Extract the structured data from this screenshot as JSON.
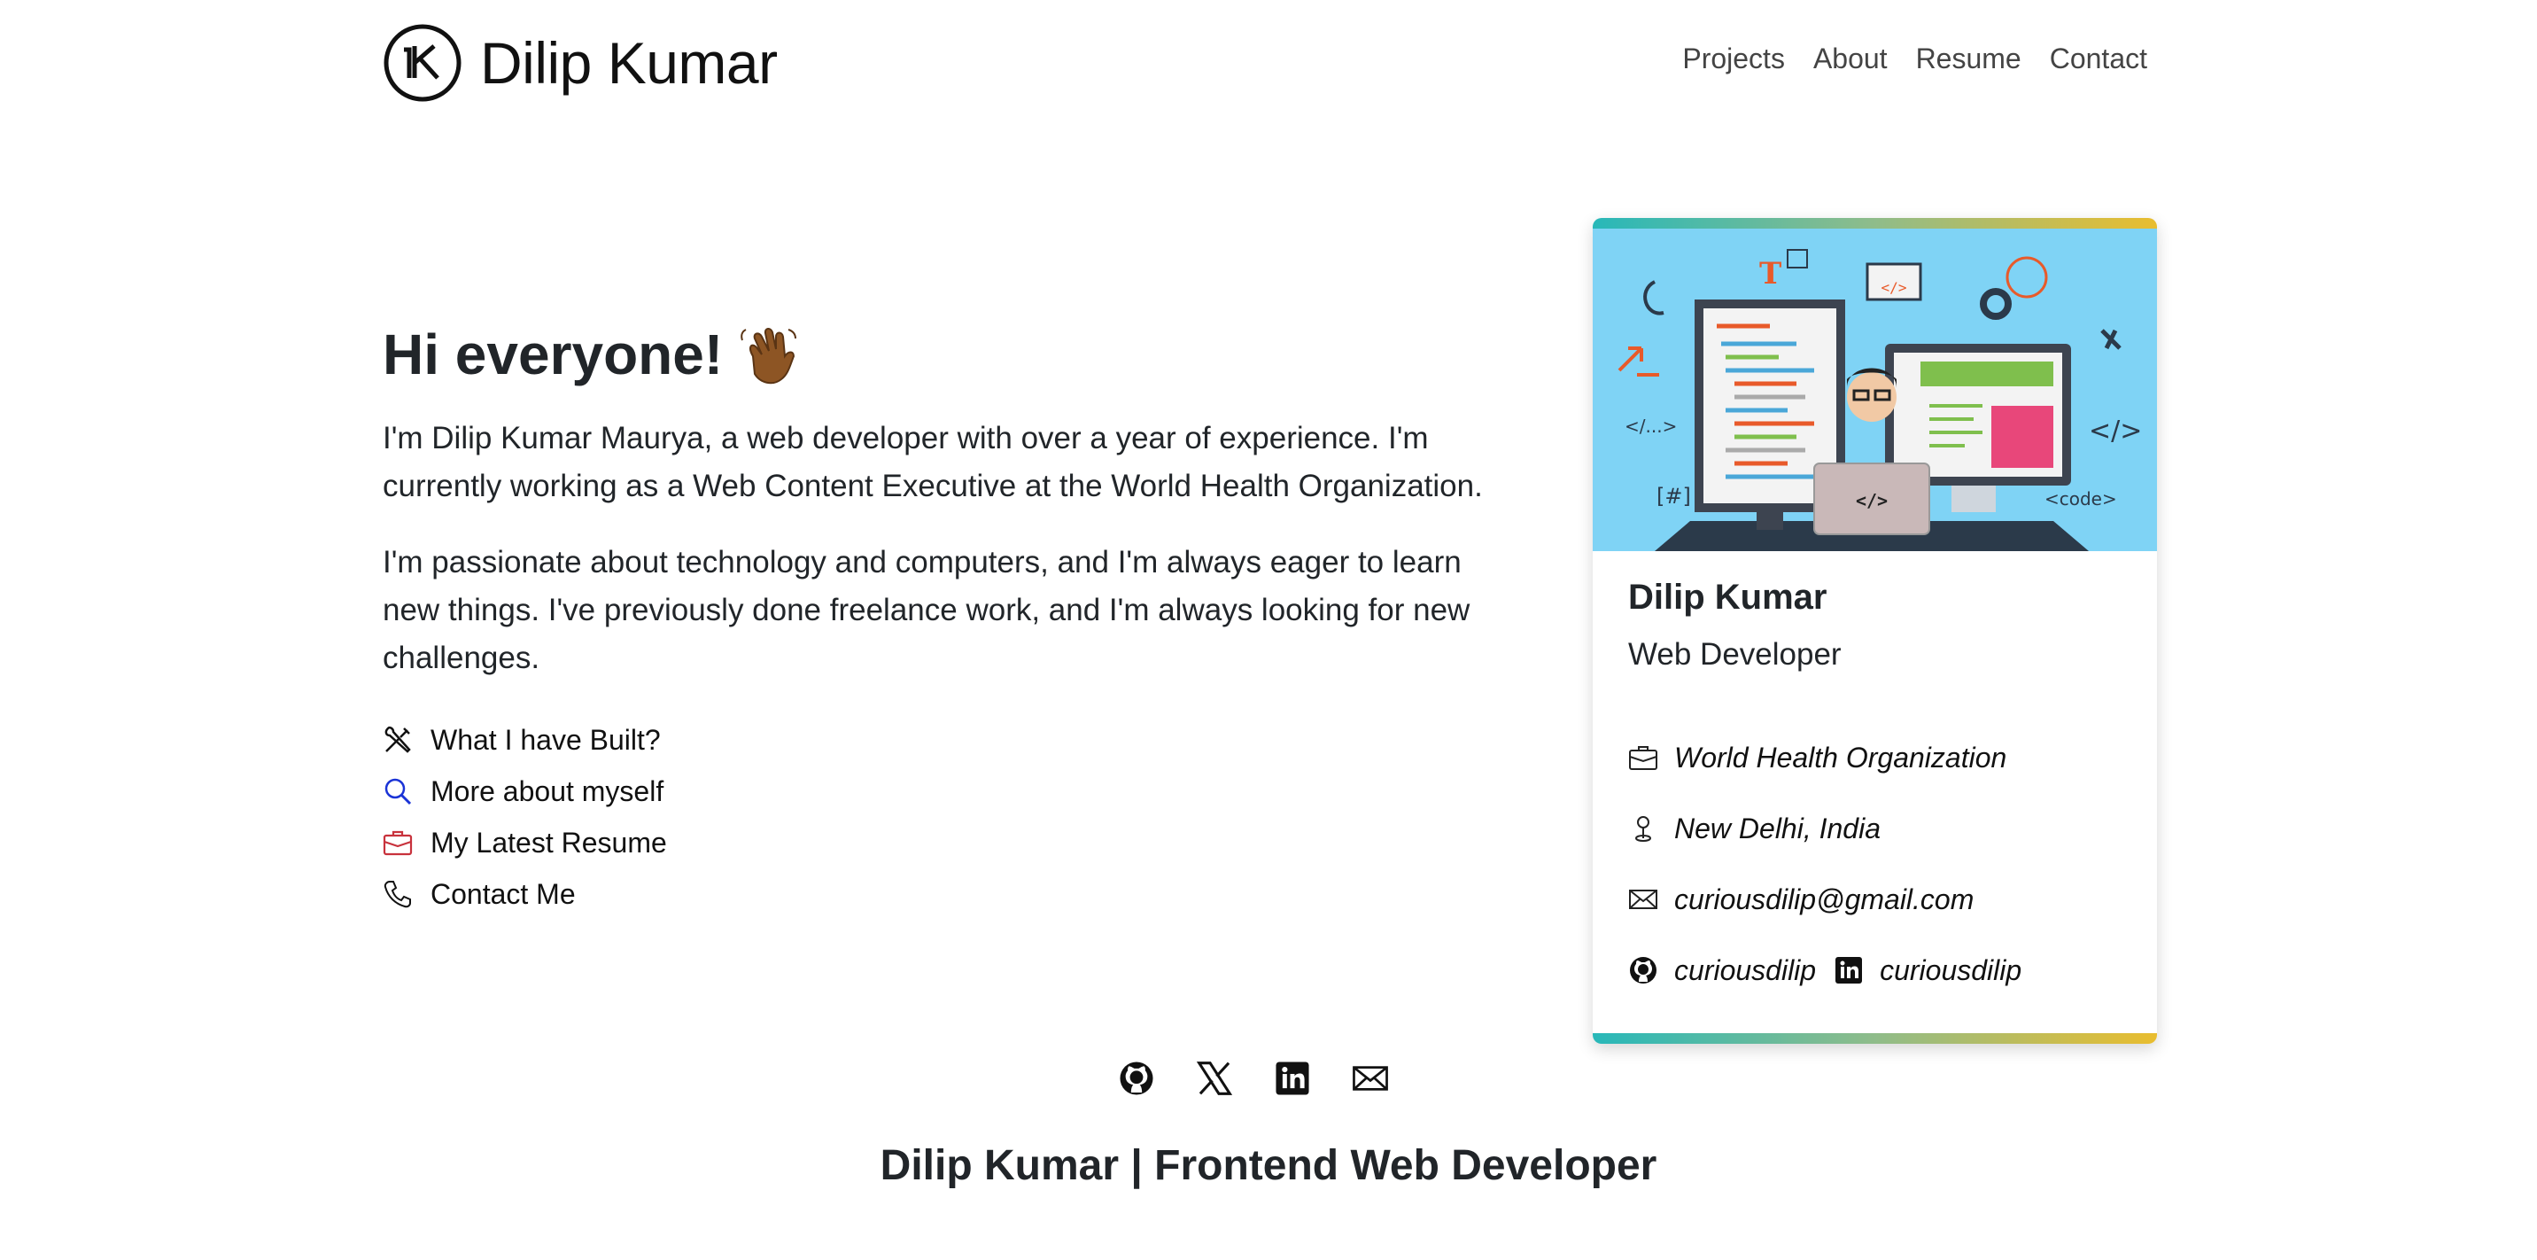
{
  "header": {
    "brand_name": "Dilip Kumar",
    "nav": [
      "Projects",
      "About",
      "Resume",
      "Contact"
    ]
  },
  "intro": {
    "greeting": "Hi everyone!",
    "paragraph1": "I'm Dilip Kumar Maurya, a web developer with over a year of experience. I'm currently working as a Web Content Executive at the World Health Organization.",
    "paragraph2": "I'm passionate about technology and computers, and I'm always eager to learn new things. I've previously done freelance work, and I'm always looking for new challenges.",
    "links": [
      {
        "label": "What I have Built?",
        "icon": "tools-icon",
        "color": "#111111"
      },
      {
        "label": "More about myself",
        "icon": "search-icon",
        "color": "#1a33d6"
      },
      {
        "label": "My Latest Resume",
        "icon": "briefcase-icon",
        "color": "#c8323c"
      },
      {
        "label": "Contact Me",
        "icon": "phone-icon",
        "color": "#111111"
      }
    ]
  },
  "card": {
    "name": "Dilip Kumar",
    "role": "Web Developer",
    "organization": "World Health Organization",
    "location": "New Delhi, India",
    "email": "curiousdilip@gmail.com",
    "github": "curiousdilip",
    "linkedin": "curiousdilip",
    "hero_labels": {
      "tag1": "</...>",
      "tag2": "[#]",
      "tag3": "</>",
      "tag4": "<code>",
      "tag5": "</>",
      "laptop": "</>",
      "letter": "T"
    }
  },
  "footer": {
    "icons": [
      "github-icon",
      "x-icon",
      "linkedin-icon",
      "mail-icon"
    ],
    "title": "Dilip Kumar | Frontend Web Developer"
  },
  "colors": {
    "hero_bg": "#7fd3f5",
    "gradient_start": "#28b8b9",
    "gradient_end": "#e9bd2f",
    "text": "#212529"
  }
}
